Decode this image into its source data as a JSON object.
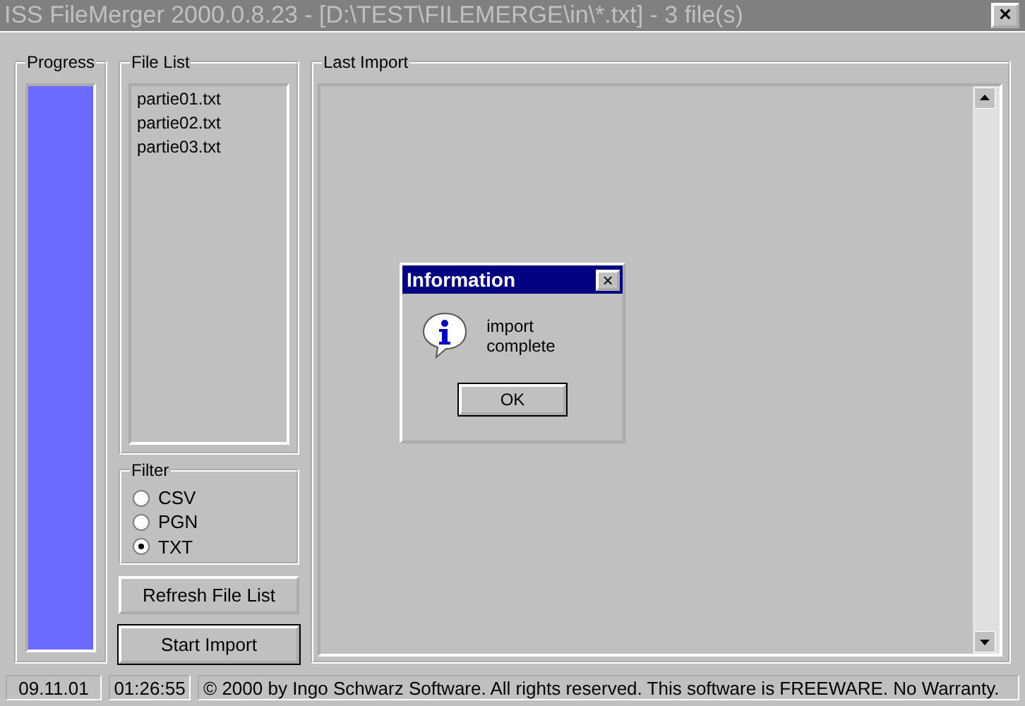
{
  "window": {
    "title": "ISS FileMerger 2000.0.8.23 - [D:\\TEST\\FILEMERGE\\in\\*.txt] - 3 file(s)",
    "close": "×",
    "active": false
  },
  "progress": {
    "label": "Progress",
    "level": 1
  },
  "file_list": {
    "label": "File List",
    "items": [
      {
        "name": "partie01.txt",
        "selected": false
      },
      {
        "name": "partie02.txt",
        "selected": false
      },
      {
        "name": "partie03.txt",
        "selected": false
      }
    ]
  },
  "filter": {
    "label": "Filter",
    "options": [
      {
        "label": "CSV",
        "selected": false
      },
      {
        "label": "PGN",
        "selected": false
      },
      {
        "label": "TXT",
        "selected": true
      }
    ]
  },
  "buttons": [
    {
      "label": "Refresh File List",
      "default": false
    },
    {
      "label": "Start Import",
      "default": true
    }
  ],
  "last_import": {
    "label": "Last Import"
  },
  "dialog": {
    "title": "Information",
    "close": "×",
    "message": "import complete",
    "ok": "OK"
  },
  "status_bar": [
    "09.11.01",
    "01:26:55",
    "© 2000 by Ingo Schwarz Software. All rights reserved. This software is FREEWARE. No Warranty."
  ]
}
